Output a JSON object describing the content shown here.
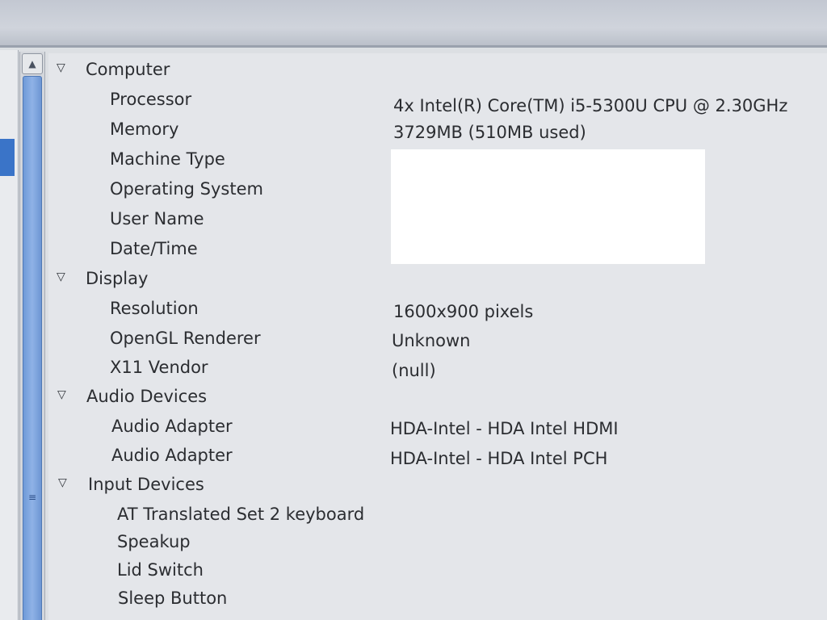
{
  "tree": {
    "computer": {
      "label": "Computer",
      "processor": {
        "label": "Processor",
        "value": "4x Intel(R) Core(TM) i5-5300U CPU @ 2.30GHz"
      },
      "memory": {
        "label": "Memory",
        "value": "3729MB (510MB used)"
      },
      "machine_type": {
        "label": "Machine Type"
      },
      "operating_system": {
        "label": "Operating System"
      },
      "user_name": {
        "label": "User Name"
      },
      "date_time": {
        "label": "Date/Time"
      }
    },
    "display": {
      "label": "Display",
      "resolution": {
        "label": "Resolution",
        "value": "1600x900 pixels"
      },
      "opengl_renderer": {
        "label": "OpenGL Renderer",
        "value": "Unknown"
      },
      "x11_vendor": {
        "label": "X11 Vendor",
        "value": "(null)"
      }
    },
    "audio_devices": {
      "label": "Audio Devices",
      "adapter_1": {
        "label": "Audio Adapter",
        "value": "HDA-Intel - HDA Intel HDMI"
      },
      "adapter_2": {
        "label": "Audio Adapter",
        "value": "HDA-Intel - HDA Intel PCH"
      }
    },
    "input_devices": {
      "label": "Input Devices",
      "items": [
        "AT Translated Set 2 keyboard",
        "Speakup",
        "Lid Switch",
        "Sleep Button"
      ]
    }
  },
  "icons": {
    "expand": "triangle-down",
    "scroll_up": "chevron-up",
    "grip": "grip-lines"
  }
}
